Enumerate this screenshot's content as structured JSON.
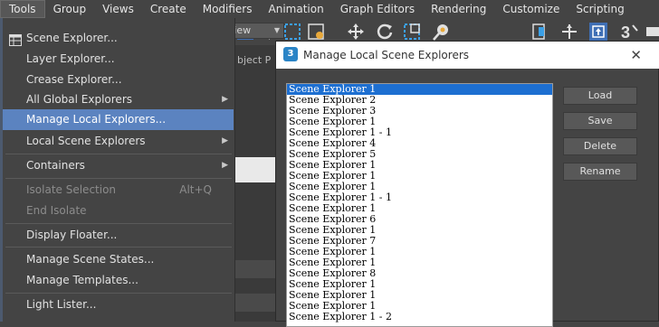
{
  "menubar": {
    "items": [
      "Tools",
      "Group",
      "Views",
      "Create",
      "Modifiers",
      "Animation",
      "Graph Editors",
      "Rendering",
      "Customize",
      "Scripting"
    ]
  },
  "toolbar": {
    "view_dropdown": "View",
    "partial_label": "bject P"
  },
  "tools_menu": {
    "items": [
      {
        "label": "Scene Explorer...",
        "shortcut": "",
        "submenu": false,
        "disabled": false,
        "icon": "table-icon"
      },
      {
        "label": "Layer Explorer...",
        "shortcut": "",
        "submenu": false,
        "disabled": false
      },
      {
        "label": "Crease Explorer...",
        "shortcut": "",
        "submenu": false,
        "disabled": false
      },
      {
        "label": "All Global Explorers",
        "shortcut": "",
        "submenu": true,
        "disabled": false
      },
      {
        "label": "Manage Local Explorers...",
        "shortcut": "",
        "submenu": false,
        "disabled": false,
        "highlighted": true
      },
      {
        "label": "Local Scene Explorers",
        "shortcut": "",
        "submenu": true,
        "disabled": false
      },
      {
        "label": "Containers",
        "shortcut": "",
        "submenu": true,
        "disabled": false
      },
      {
        "label": "Isolate Selection",
        "shortcut": "Alt+Q",
        "submenu": false,
        "disabled": true
      },
      {
        "label": "End Isolate",
        "shortcut": "",
        "submenu": false,
        "disabled": true
      },
      {
        "label": "Display Floater...",
        "shortcut": "",
        "submenu": false,
        "disabled": false
      },
      {
        "label": "Manage Scene States...",
        "shortcut": "",
        "submenu": false,
        "disabled": false
      },
      {
        "label": "Manage Templates...",
        "shortcut": "",
        "submenu": false,
        "disabled": false
      },
      {
        "label": "Light Lister...",
        "shortcut": "",
        "submenu": false,
        "disabled": false
      }
    ],
    "submenu_arrow": "▶"
  },
  "dialog": {
    "logo": "3",
    "title": "Manage Local Scene Explorers",
    "close": "✕",
    "list": [
      "Scene Explorer 1",
      "Scene Explorer 2",
      "Scene Explorer 3",
      "Scene Explorer 1",
      "Scene Explorer 1 - 1",
      "Scene Explorer 4",
      "Scene Explorer 5",
      "Scene Explorer 1",
      "Scene Explorer 1",
      "Scene Explorer 1",
      "Scene Explorer 1 - 1",
      "Scene Explorer 1",
      "Scene Explorer 6",
      "Scene Explorer 1",
      "Scene Explorer 7",
      "Scene Explorer 1",
      "Scene Explorer 1",
      "Scene Explorer 8",
      "Scene Explorer 1",
      "Scene Explorer 1",
      "Scene Explorer 1",
      "Scene Explorer 1 - 2"
    ],
    "selected_index": 0,
    "buttons": {
      "load": "Load",
      "save": "Save",
      "delete": "Delete",
      "rename": "Rename"
    }
  },
  "colors": {
    "menu_bg": "#444444",
    "highlight": "#5b83c0",
    "list_selection": "#1d6fd1",
    "dialog_title_bg": "#ffffff"
  }
}
